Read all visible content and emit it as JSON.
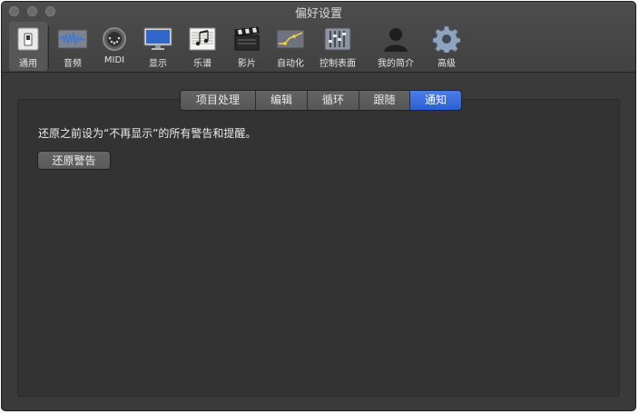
{
  "window": {
    "title": "偏好设置"
  },
  "toolbar": {
    "items": [
      {
        "label": "通用",
        "icon": "general-switch-icon"
      },
      {
        "label": "音频",
        "icon": "audio-waveform-icon"
      },
      {
        "label": "MIDI",
        "icon": "midi-connector-icon"
      },
      {
        "label": "显示",
        "icon": "display-monitor-icon"
      },
      {
        "label": "乐谱",
        "icon": "score-notes-icon"
      },
      {
        "label": "影片",
        "icon": "movie-clapper-icon"
      },
      {
        "label": "自动化",
        "icon": "automation-curve-icon"
      },
      {
        "label": "控制表面",
        "icon": "control-surface-faders-icon"
      },
      {
        "label": "我的简介",
        "icon": "user-profile-icon"
      },
      {
        "label": "高级",
        "icon": "advanced-gear-icon"
      }
    ],
    "selected": "通用"
  },
  "tabs": [
    {
      "label": "项目处理"
    },
    {
      "label": "编辑"
    },
    {
      "label": "循环"
    },
    {
      "label": "跟随"
    },
    {
      "label": "通知"
    }
  ],
  "active_tab": "通知",
  "content": {
    "message": "还原之前设为“不再显示”的所有警告和提醒。",
    "button_label": "还原警告"
  },
  "colors": {
    "window_bg": "#3a3a3a",
    "panel_bg": "#333333",
    "active_tab": "#2f62d4"
  }
}
